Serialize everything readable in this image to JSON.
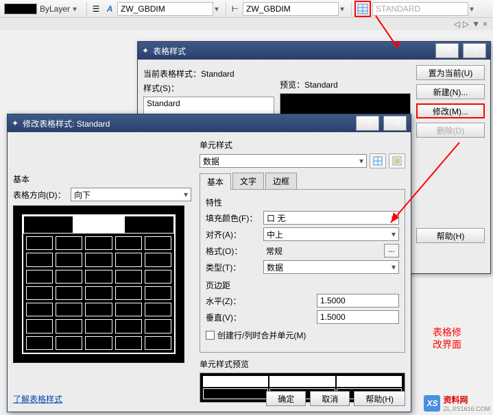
{
  "toolbar": {
    "layer_color_name": "ByLayer",
    "field1": "ZW_GBDIM",
    "field2": "ZW_GBDIM",
    "field3": "STANDARD"
  },
  "nav": {
    "left": "◁",
    "right": "▷",
    "down": "▼",
    "close": "×"
  },
  "dlg1": {
    "title": "表格样式",
    "help_icon": "?",
    "close_icon": "×",
    "current_label": "当前表格样式：",
    "current_value": "Standard",
    "styles_label": "样式(S)：",
    "preview_label": "预览：",
    "preview_value": "Standard",
    "list_item": "Standard",
    "btn_set_current": "置为当前(U)",
    "btn_new": "新建(N)...",
    "btn_modify": "修改(M)...",
    "btn_delete": "删除(D)",
    "btn_help": "帮助(H)"
  },
  "dlg2": {
    "title": "修改表格样式: Standard",
    "help_icon": "?",
    "close_icon": "×",
    "basic_group": "基本",
    "table_direction_label": "表格方向(D)：",
    "table_direction_value": "向下",
    "cell_style_group": "单元样式",
    "cell_style_value": "数据",
    "tab_basic": "基本",
    "tab_text": "文字",
    "tab_border": "边框",
    "properties_group": "特性",
    "fill_color_label": "填充颜色(F)：",
    "fill_color_value": "口 无",
    "align_label": "对齐(A)：",
    "align_value": "中上",
    "format_label": "格式(O)：",
    "format_value": "常规",
    "format_btn": "...",
    "type_label": "类型(T)：",
    "type_value": "数据",
    "margin_group": "页边距",
    "horiz_label": "水平(Z)：",
    "horiz_value": "1.5000",
    "vert_label": "垂直(V)：",
    "vert_value": "1.5000",
    "merge_checkbox": "创建行/列时合并单元(M)",
    "cell_preview_group": "单元样式预览",
    "link_text": "了解表格样式",
    "btn_ok": "确定",
    "btn_cancel": "取消",
    "btn_help": "帮助(H)"
  },
  "annotation": "表格修\n改界面",
  "watermark": {
    "logo": "XS",
    "name": "资料网",
    "url": "ZL.XS1616.COM"
  }
}
